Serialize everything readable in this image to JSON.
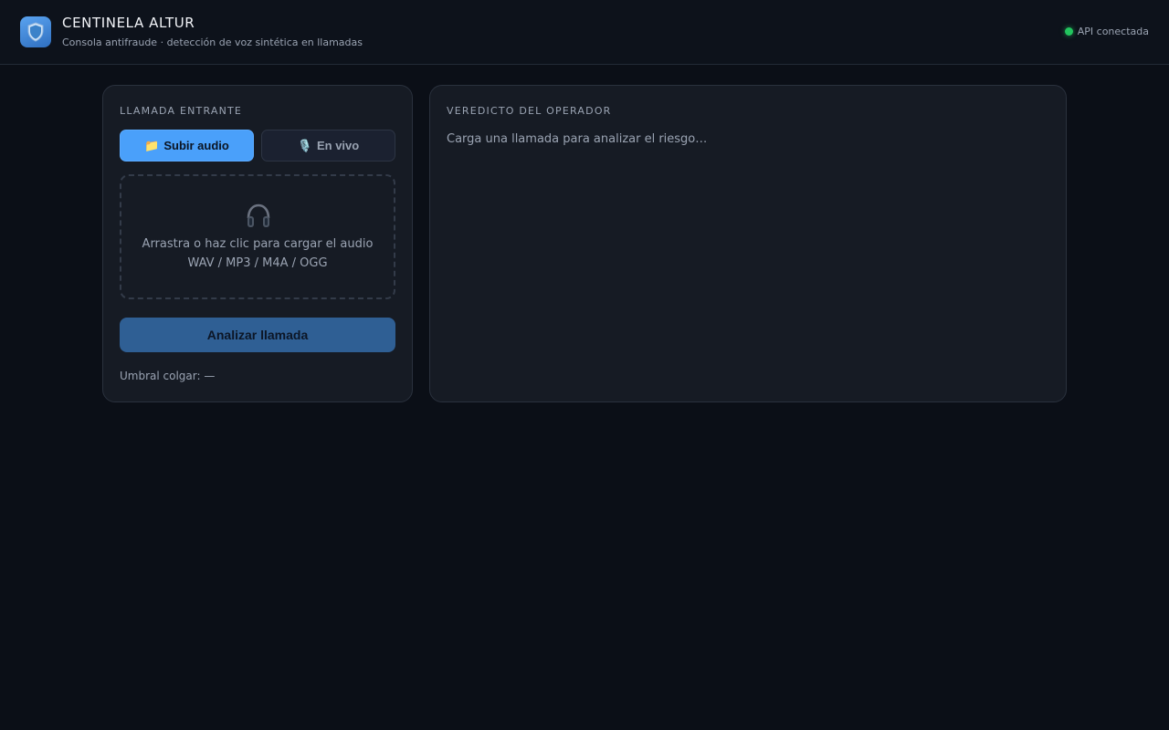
{
  "header": {
    "title": "CENTINELA ALTUR",
    "subtitle": "Consola antifraude · detección de voz sintética en llamadas",
    "logo_icon": "shield-icon",
    "api_status": "API conectada",
    "api_status_color": "#22c55e"
  },
  "incoming": {
    "heading": "LLAMADA ENTRANTE",
    "tabs": [
      {
        "label": "Subir audio",
        "icon": "folder-icon",
        "glyph": "📁",
        "active": true
      },
      {
        "label": "En vivo",
        "icon": "microphone-icon",
        "glyph": "🎙️",
        "active": false
      }
    ],
    "dropzone": {
      "icon": "headphones-icon",
      "line1": "Arrastra o haz clic para cargar el audio",
      "line2": "WAV / MP3 / M4A / OGG"
    },
    "analyze_label": "Analizar llamada",
    "threshold_text": "Umbral colgar: —"
  },
  "verdict": {
    "heading": "VEREDICTO DEL OPERADOR",
    "placeholder": "Carga una llamada para analizar el riesgo…"
  },
  "colors": {
    "accent": "#4aa0fa",
    "background": "#0b0f17",
    "panel": "#161b24"
  }
}
